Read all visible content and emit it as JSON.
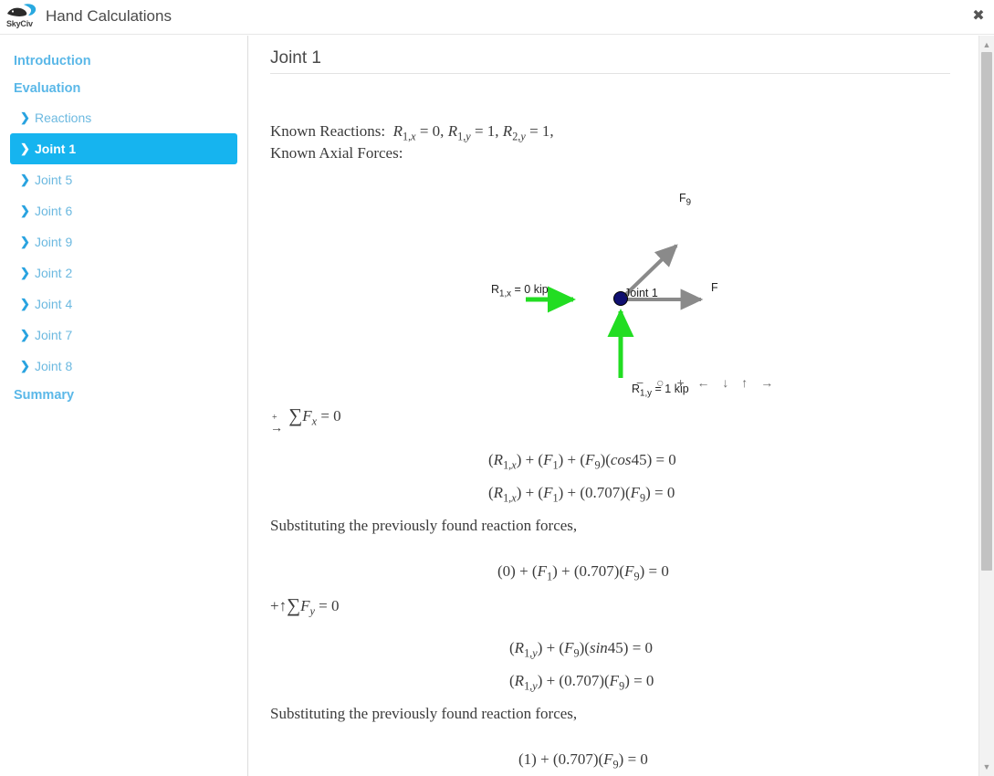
{
  "header": {
    "logo_name": "skyciv-logo",
    "logo_text": "SkyCiv",
    "title": "Hand Calculations",
    "close_label": "✖"
  },
  "sidebar": {
    "sections": [
      {
        "type": "top",
        "label": "Introduction",
        "active": false
      },
      {
        "type": "top",
        "label": "Evaluation",
        "active": false
      },
      {
        "type": "sub",
        "label": "Reactions",
        "active": false
      },
      {
        "type": "sub",
        "label": "Joint 1",
        "active": true
      },
      {
        "type": "sub",
        "label": "Joint 5",
        "active": false
      },
      {
        "type": "sub",
        "label": "Joint 6",
        "active": false
      },
      {
        "type": "sub",
        "label": "Joint 9",
        "active": false
      },
      {
        "type": "sub",
        "label": "Joint 2",
        "active": false
      },
      {
        "type": "sub",
        "label": "Joint 4",
        "active": false
      },
      {
        "type": "sub",
        "label": "Joint 7",
        "active": false
      },
      {
        "type": "sub",
        "label": "Joint 8",
        "active": false
      },
      {
        "type": "top",
        "label": "Summary",
        "active": false
      }
    ],
    "chevron": "❯",
    "active_bg": "#16b4ef",
    "link_color": "#5bb8e8"
  },
  "content": {
    "page_title": "Joint 1",
    "known_reactions_label": "Known Reactions:",
    "known_reactions_values": "R1,x = 0, R1,y = 1, R2,y = 1,",
    "known_axial_label": "Known Axial Forces:",
    "sum_fx_heading": "+→ ∑Fx = 0",
    "sum_fy_heading": "+↑ ∑Fy = 0",
    "substituting_text": "Substituting the previously found reaction forces,",
    "equations_x": [
      "(R1,x) + (F1) + (F9)(cos45) = 0",
      "(R1,x) + (F1) + (0.707)(F9) = 0"
    ],
    "equation_x_substituted": "(0) + (F1) + (0.707)(F9) = 0",
    "equations_y": [
      "(R1,y) + (F9)(sin45) = 0",
      "(R1,y) + (0.707)(F9) = 0"
    ],
    "equation_y_substituted": "(1) + (0.707)(F9) = 0"
  },
  "diagram": {
    "joint_label": "Joint 1",
    "reaction_x_label": "R1,x = 0 kip",
    "reaction_y_label": "R1,y = 1 kip",
    "force_9_label": "F9",
    "force_1_label": "F",
    "reaction_color": "#22dd22",
    "force_color": "#8a8a8a",
    "joint_color": "#101070",
    "controls": [
      {
        "name": "zoom-out",
        "glyph": "−"
      },
      {
        "name": "zoom-reset",
        "glyph": "○"
      },
      {
        "name": "zoom-in",
        "glyph": "+"
      },
      {
        "name": "pan-left",
        "glyph": "←"
      },
      {
        "name": "pan-down",
        "glyph": "↓"
      },
      {
        "name": "pan-up",
        "glyph": "↑"
      },
      {
        "name": "pan-right",
        "glyph": "→"
      }
    ]
  },
  "scrollbar": {
    "up_glyph": "▲",
    "down_glyph": "▼"
  }
}
